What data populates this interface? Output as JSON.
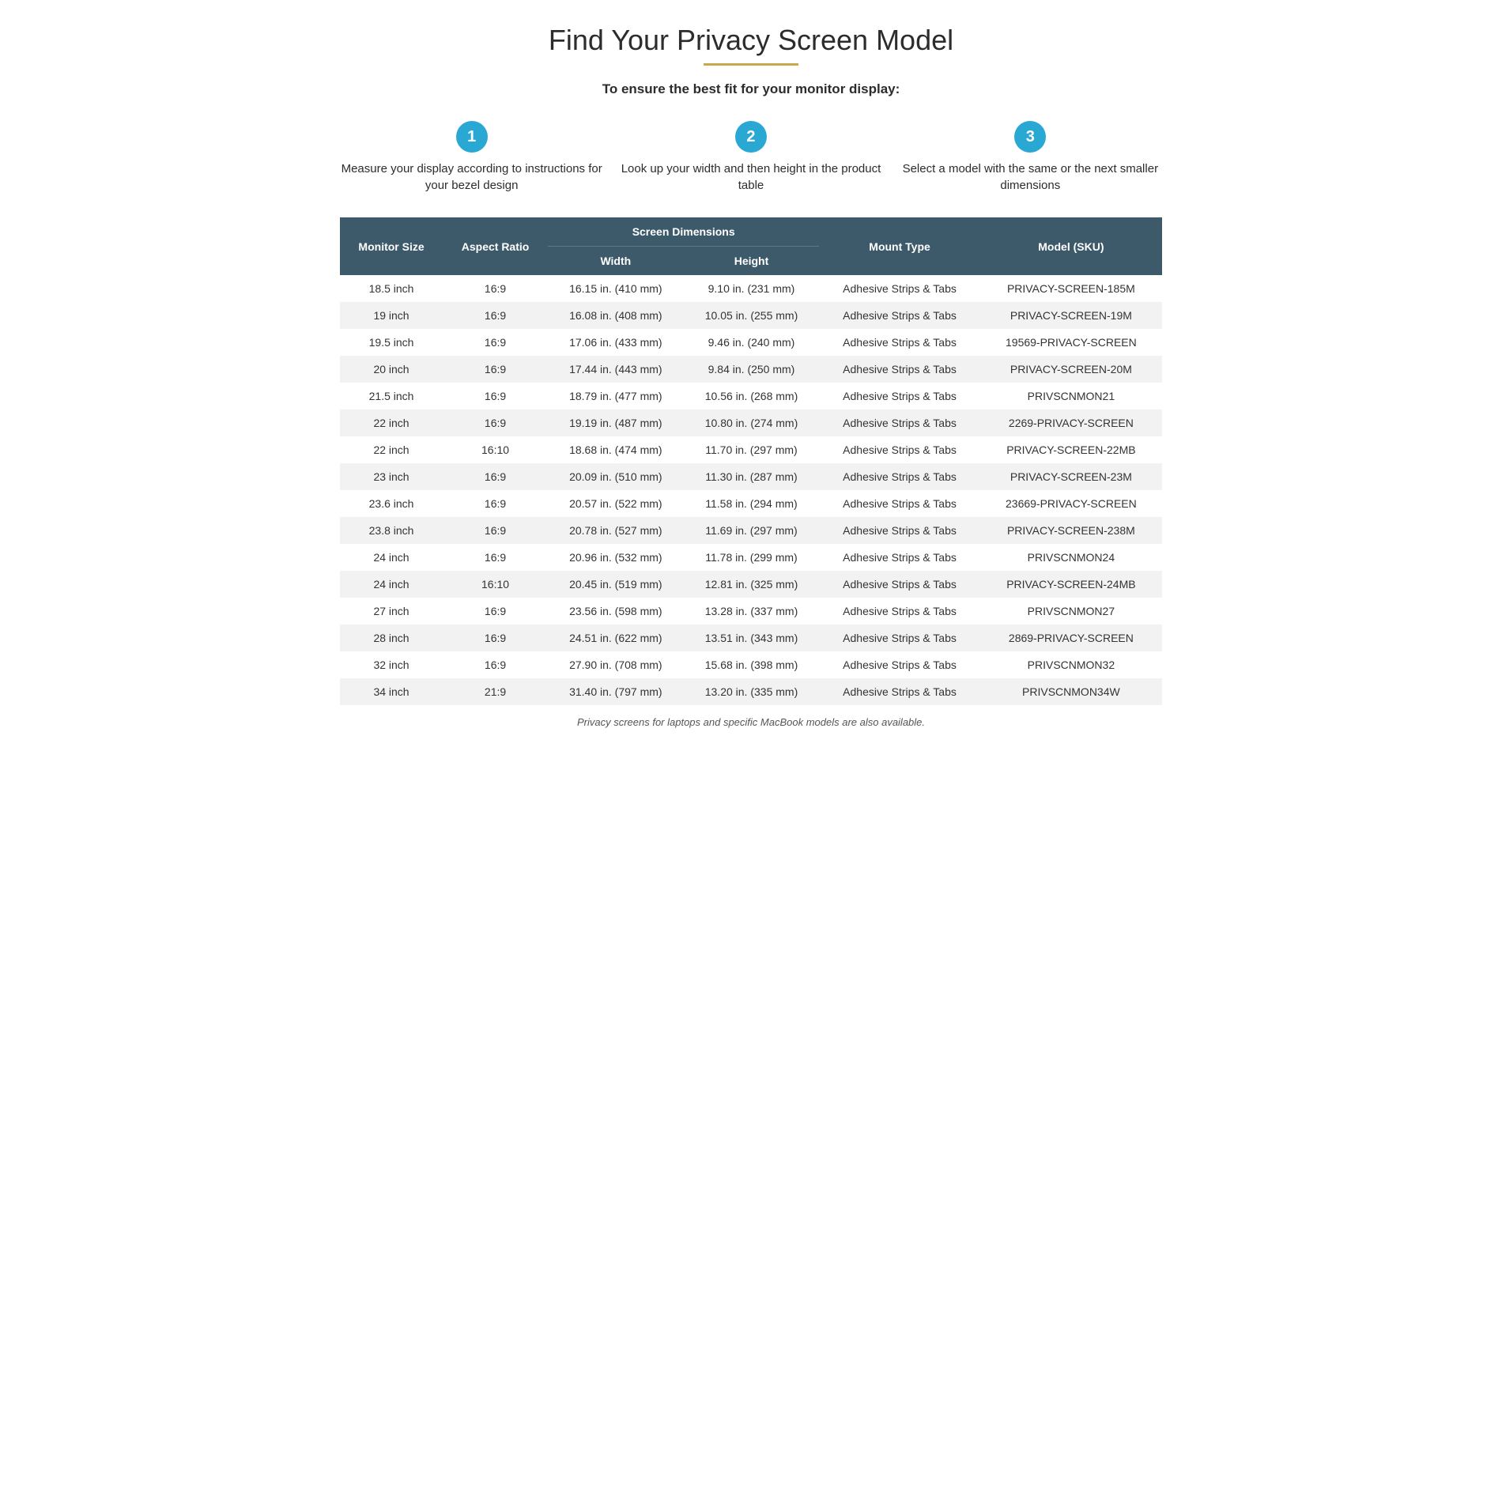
{
  "page": {
    "title": "Find Your Privacy Screen Model",
    "gold_line": true,
    "subtitle": "To ensure the best fit for your monitor display:",
    "steps": [
      {
        "number": "1",
        "text": "Measure your display according to instructions for your bezel design"
      },
      {
        "number": "2",
        "text": "Look up your width and then height in the product table"
      },
      {
        "number": "3",
        "text": "Select a model with the same or the next smaller dimensions"
      }
    ],
    "table": {
      "headers": {
        "col1": "Monitor Size",
        "col2": "Aspect Ratio",
        "col3_group": "Screen Dimensions",
        "col3a": "Width",
        "col3b": "Height",
        "col4": "Mount Type",
        "col5": "Model (SKU)"
      },
      "rows": [
        {
          "size": "18.5 inch",
          "ratio": "16:9",
          "width": "16.15 in. (410 mm)",
          "height": "9.10 in. (231 mm)",
          "mount": "Adhesive Strips & Tabs",
          "sku": "PRIVACY-SCREEN-185M"
        },
        {
          "size": "19 inch",
          "ratio": "16:9",
          "width": "16.08 in. (408 mm)",
          "height": "10.05 in. (255 mm)",
          "mount": "Adhesive Strips & Tabs",
          "sku": "PRIVACY-SCREEN-19M"
        },
        {
          "size": "19.5 inch",
          "ratio": "16:9",
          "width": "17.06 in. (433 mm)",
          "height": "9.46 in. (240 mm)",
          "mount": "Adhesive Strips & Tabs",
          "sku": "19569-PRIVACY-SCREEN"
        },
        {
          "size": "20 inch",
          "ratio": "16:9",
          "width": "17.44 in. (443 mm)",
          "height": "9.84 in. (250 mm)",
          "mount": "Adhesive Strips & Tabs",
          "sku": "PRIVACY-SCREEN-20M"
        },
        {
          "size": "21.5 inch",
          "ratio": "16:9",
          "width": "18.79 in. (477 mm)",
          "height": "10.56 in. (268 mm)",
          "mount": "Adhesive Strips & Tabs",
          "sku": "PRIVSCNMON21"
        },
        {
          "size": "22 inch",
          "ratio": "16:9",
          "width": "19.19 in. (487 mm)",
          "height": "10.80 in. (274 mm)",
          "mount": "Adhesive Strips & Tabs",
          "sku": "2269-PRIVACY-SCREEN"
        },
        {
          "size": "22 inch",
          "ratio": "16:10",
          "width": "18.68 in. (474 mm)",
          "height": "11.70 in. (297 mm)",
          "mount": "Adhesive Strips & Tabs",
          "sku": "PRIVACY-SCREEN-22MB"
        },
        {
          "size": "23 inch",
          "ratio": "16:9",
          "width": "20.09 in. (510 mm)",
          "height": "11.30 in. (287 mm)",
          "mount": "Adhesive Strips & Tabs",
          "sku": "PRIVACY-SCREEN-23M"
        },
        {
          "size": "23.6 inch",
          "ratio": "16:9",
          "width": "20.57 in. (522 mm)",
          "height": "11.58 in. (294 mm)",
          "mount": "Adhesive Strips & Tabs",
          "sku": "23669-PRIVACY-SCREEN"
        },
        {
          "size": "23.8 inch",
          "ratio": "16:9",
          "width": "20.78 in. (527 mm)",
          "height": "11.69 in. (297 mm)",
          "mount": "Adhesive Strips & Tabs",
          "sku": "PRIVACY-SCREEN-238M"
        },
        {
          "size": "24 inch",
          "ratio": "16:9",
          "width": "20.96 in. (532 mm)",
          "height": "11.78 in. (299 mm)",
          "mount": "Adhesive Strips & Tabs",
          "sku": "PRIVSCNMON24"
        },
        {
          "size": "24 inch",
          "ratio": "16:10",
          "width": "20.45 in. (519 mm)",
          "height": "12.81 in. (325 mm)",
          "mount": "Adhesive Strips & Tabs",
          "sku": "PRIVACY-SCREEN-24MB"
        },
        {
          "size": "27 inch",
          "ratio": "16:9",
          "width": "23.56 in. (598 mm)",
          "height": "13.28 in. (337 mm)",
          "mount": "Adhesive Strips & Tabs",
          "sku": "PRIVSCNMON27"
        },
        {
          "size": "28 inch",
          "ratio": "16:9",
          "width": "24.51 in. (622 mm)",
          "height": "13.51 in. (343 mm)",
          "mount": "Adhesive Strips & Tabs",
          "sku": "2869-PRIVACY-SCREEN"
        },
        {
          "size": "32 inch",
          "ratio": "16:9",
          "width": "27.90 in. (708 mm)",
          "height": "15.68 in. (398 mm)",
          "mount": "Adhesive Strips & Tabs",
          "sku": "PRIVSCNMON32"
        },
        {
          "size": "34 inch",
          "ratio": "21:9",
          "width": "31.40 in. (797 mm)",
          "height": "13.20 in. (335 mm)",
          "mount": "Adhesive Strips & Tabs",
          "sku": "PRIVSCNMON34W"
        }
      ]
    },
    "footer_note": "Privacy screens for laptops and specific MacBook models are also available."
  }
}
